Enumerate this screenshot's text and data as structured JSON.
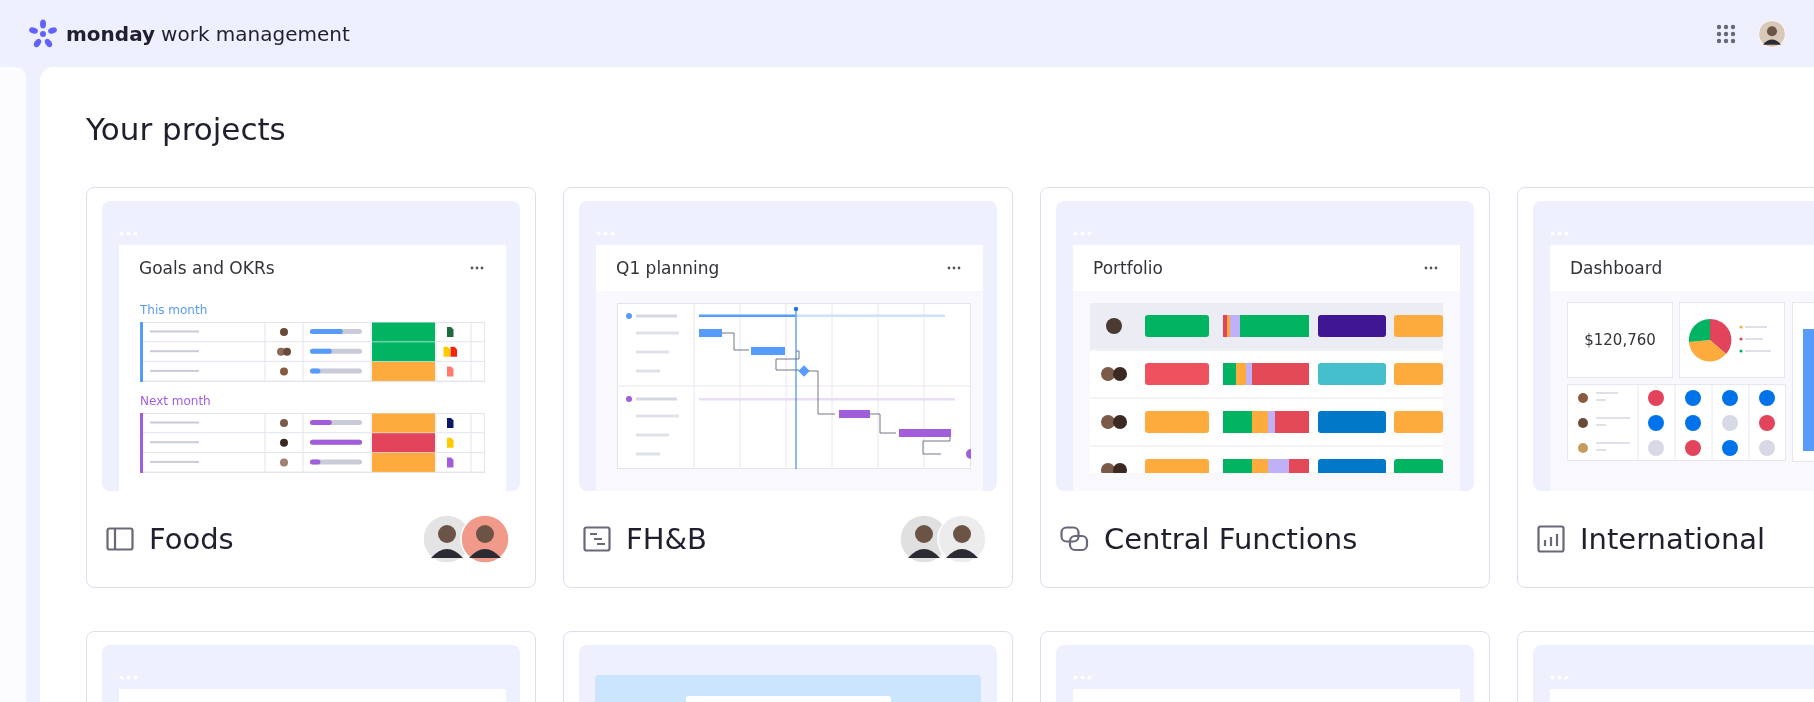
{
  "header": {
    "brand": "monday",
    "product": "work management"
  },
  "page_title": "Your projects",
  "projects": [
    {
      "name": "Foods",
      "preview": {
        "kind": "table",
        "title": "Goals and OKRs",
        "groups": [
          {
            "label": "This month",
            "color": "#579bfc"
          },
          {
            "label": "Next month",
            "color": "#a25ddc"
          }
        ]
      },
      "avatars": [
        {
          "color": "#e4e4e4"
        },
        {
          "color": "#f29a8a"
        }
      ]
    },
    {
      "name": "FH&B",
      "preview": {
        "kind": "gantt",
        "title": "Q1 planning"
      },
      "avatars": [
        {
          "color": "#e0e0e0"
        },
        {
          "color": "#ececec"
        }
      ]
    },
    {
      "name": "Central Functions",
      "preview": {
        "kind": "portfolio",
        "title": "Portfolio"
      }
    },
    {
      "name": "International",
      "preview": {
        "kind": "dashboard",
        "title": "Dashboard",
        "value": "$120,760"
      }
    }
  ],
  "more_projects": [
    {
      "preview": {
        "kind": "window"
      }
    },
    {
      "preview": {
        "kind": "banner"
      }
    },
    {
      "preview": {
        "kind": "window"
      }
    },
    {
      "preview": {
        "kind": "window"
      }
    }
  ]
}
